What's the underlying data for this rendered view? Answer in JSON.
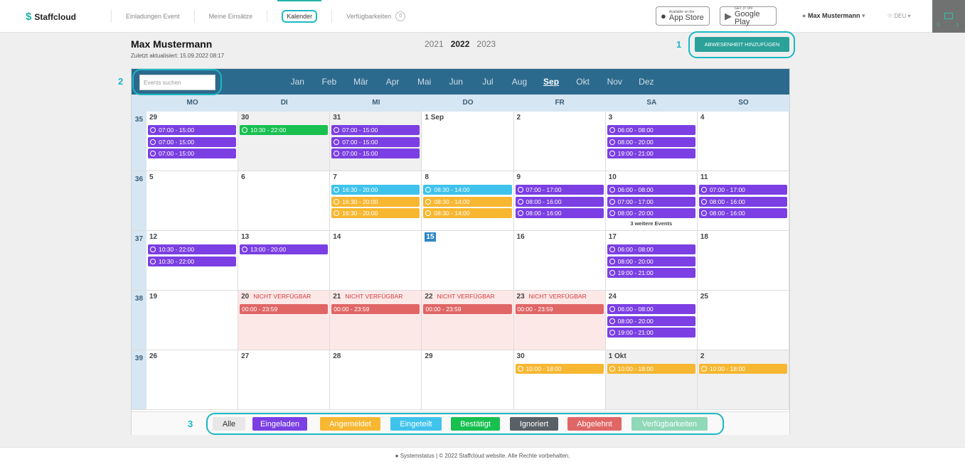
{
  "app": {
    "logo": "Staffcloud"
  },
  "nav": [
    {
      "label": "Einladungen Event",
      "active": false
    },
    {
      "label": "Meine Einsätze",
      "active": false
    },
    {
      "label": "Kalender",
      "active": true
    },
    {
      "label": "Verfügbarkeiten",
      "active": false,
      "badge": "0"
    }
  ],
  "stores": {
    "apple_small": "Available on the",
    "apple_big": "App Store",
    "google_small": "GET IT ON",
    "google_big": "Google Play"
  },
  "header": {
    "user": "Max Mustermann",
    "lang": "DEU",
    "mail_count_a": "0",
    "mail_count_b": "1"
  },
  "page": {
    "title": "Max Mustermann",
    "updated": "Zuletzt aktualisiert: 15.09.2022 08:17",
    "add_button": "ABWESENHEIT HINZUFÜGEN"
  },
  "years": [
    "2021",
    "2022",
    "2023"
  ],
  "current_year": "2022",
  "search": {
    "placeholder": "Events suchen"
  },
  "months": [
    "Jan",
    "Feb",
    "Mär",
    "Apr",
    "Mai",
    "Jun",
    "Jul",
    "Aug",
    "Sep",
    "Okt",
    "Nov",
    "Dez"
  ],
  "selected_month": "Sep",
  "weekdays": [
    "MO",
    "DI",
    "MI",
    "DO",
    "FR",
    "SA",
    "SO"
  ],
  "callouts": [
    "1",
    "2",
    "3"
  ],
  "colors": {
    "purple": "#7b3fe4",
    "green": "#17c04f",
    "blue": "#3fc3ec",
    "orange": "#f7b731",
    "red": "#e06666",
    "teal": "#2aa199",
    "darkgray": "#5a6166",
    "mint": "#8fd8b8"
  },
  "weeks": [
    {
      "num": "35",
      "days": [
        {
          "d": "29",
          "bg": "white",
          "events": [
            {
              "t": "07:00 - 15:00",
              "c": "purple"
            },
            {
              "t": "07:00 - 15:00",
              "c": "purple"
            },
            {
              "t": "07:00 - 15:00",
              "c": "purple"
            }
          ]
        },
        {
          "d": "30",
          "bg": "gray",
          "events": [
            {
              "t": "10:30 - 22:00",
              "c": "green"
            }
          ]
        },
        {
          "d": "31",
          "bg": "gray",
          "events": [
            {
              "t": "07:00 - 15:00",
              "c": "purple"
            },
            {
              "t": "07:00 - 15:00",
              "c": "purple"
            },
            {
              "t": "07:00 - 15:00",
              "c": "purple"
            }
          ]
        },
        {
          "d": "1 Sep",
          "bg": "white",
          "events": []
        },
        {
          "d": "2",
          "bg": "white",
          "events": []
        },
        {
          "d": "3",
          "bg": "white",
          "events": [
            {
              "t": "06:00 - 08:00",
              "c": "purple"
            },
            {
              "t": "08:00 - 20:00",
              "c": "purple"
            },
            {
              "t": "19:00 - 21:00",
              "c": "purple"
            }
          ]
        },
        {
          "d": "4",
          "bg": "white",
          "events": []
        }
      ]
    },
    {
      "num": "36",
      "days": [
        {
          "d": "5",
          "bg": "white",
          "events": []
        },
        {
          "d": "6",
          "bg": "white",
          "events": []
        },
        {
          "d": "7",
          "bg": "white",
          "events": [
            {
              "t": "16:30 - 20:00",
              "c": "blue"
            },
            {
              "t": "16:30 - 20:00",
              "c": "orange"
            },
            {
              "t": "16:30 - 20:00",
              "c": "orange"
            }
          ]
        },
        {
          "d": "8",
          "bg": "white",
          "events": [
            {
              "t": "08:30 - 14:00",
              "c": "blue"
            },
            {
              "t": "08:30 - 14:00",
              "c": "orange"
            },
            {
              "t": "08:30 - 14:00",
              "c": "orange"
            }
          ]
        },
        {
          "d": "9",
          "bg": "white",
          "events": [
            {
              "t": "07:00 - 17:00",
              "c": "purple"
            },
            {
              "t": "08:00 - 16:00",
              "c": "purple"
            },
            {
              "t": "08:00 - 16:00",
              "c": "purple"
            }
          ]
        },
        {
          "d": "10",
          "bg": "white",
          "events": [
            {
              "t": "06:00 - 08:00",
              "c": "purple"
            },
            {
              "t": "07:00 - 17:00",
              "c": "purple"
            },
            {
              "t": "08:00 - 20:00",
              "c": "purple"
            }
          ],
          "more": "3 weitere Events"
        },
        {
          "d": "11",
          "bg": "white",
          "events": [
            {
              "t": "07:00 - 17:00",
              "c": "purple"
            },
            {
              "t": "08:00 - 16:00",
              "c": "purple"
            },
            {
              "t": "08:00 - 16:00",
              "c": "purple"
            }
          ]
        }
      ]
    },
    {
      "num": "37",
      "days": [
        {
          "d": "12",
          "bg": "white",
          "events": [
            {
              "t": "10:30 - 22:00",
              "c": "purple"
            },
            {
              "t": "10:30 - 22:00",
              "c": "purple"
            }
          ]
        },
        {
          "d": "13",
          "bg": "white",
          "events": [
            {
              "t": "13:00 - 20:00",
              "c": "purple"
            }
          ]
        },
        {
          "d": "14",
          "bg": "white",
          "events": []
        },
        {
          "d": "15",
          "bg": "white",
          "today": true,
          "events": []
        },
        {
          "d": "16",
          "bg": "white",
          "events": []
        },
        {
          "d": "17",
          "bg": "white",
          "events": [
            {
              "t": "06:00 - 08:00",
              "c": "purple"
            },
            {
              "t": "08:00 - 20:00",
              "c": "purple"
            },
            {
              "t": "19:00 - 21:00",
              "c": "purple"
            }
          ]
        },
        {
          "d": "18",
          "bg": "white",
          "events": []
        }
      ]
    },
    {
      "num": "38",
      "days": [
        {
          "d": "19",
          "bg": "white",
          "events": []
        },
        {
          "d": "20",
          "bg": "pink",
          "na": "NICHT VERFÜGBAR",
          "events": [
            {
              "t": "00:00 - 23:59",
              "c": "red",
              "cal": true
            }
          ]
        },
        {
          "d": "21",
          "bg": "pink",
          "na": "NICHT VERFÜGBAR",
          "events": [
            {
              "t": "00:00 - 23:59",
              "c": "red",
              "cal": true
            }
          ]
        },
        {
          "d": "22",
          "bg": "pink",
          "na": "NICHT VERFÜGBAR",
          "events": [
            {
              "t": "00:00 - 23:59",
              "c": "red",
              "cal": true
            }
          ]
        },
        {
          "d": "23",
          "bg": "pink",
          "na": "NICHT VERFÜGBAR",
          "events": [
            {
              "t": "00:00 - 23:59",
              "c": "red",
              "cal": true
            }
          ]
        },
        {
          "d": "24",
          "bg": "white",
          "events": [
            {
              "t": "06:00 - 08:00",
              "c": "purple"
            },
            {
              "t": "08:00 - 20:00",
              "c": "purple"
            },
            {
              "t": "19:00 - 21:00",
              "c": "purple"
            }
          ]
        },
        {
          "d": "25",
          "bg": "white",
          "events": []
        }
      ]
    },
    {
      "num": "39",
      "days": [
        {
          "d": "26",
          "bg": "white",
          "events": []
        },
        {
          "d": "27",
          "bg": "white",
          "events": []
        },
        {
          "d": "28",
          "bg": "white",
          "events": []
        },
        {
          "d": "29",
          "bg": "white",
          "events": []
        },
        {
          "d": "30",
          "bg": "white",
          "events": [
            {
              "t": "10:00 - 18:00",
              "c": "orange"
            }
          ]
        },
        {
          "d": "1 Okt",
          "bg": "gray",
          "events": [
            {
              "t": "10:00 - 18:00",
              "c": "orange"
            }
          ]
        },
        {
          "d": "2",
          "bg": "gray",
          "events": [
            {
              "t": "10:00 - 18:00",
              "c": "orange"
            }
          ]
        }
      ]
    }
  ],
  "legend": [
    {
      "label": "Alle",
      "color": "#e8e8e8",
      "text": "#333"
    },
    {
      "label": "Eingeladen",
      "color": "#7b3fe4"
    },
    {
      "label": "Angemeldet",
      "color": "#f7b731"
    },
    {
      "label": "Eingeteilt",
      "color": "#3fc3ec"
    },
    {
      "label": "Bestätigt",
      "color": "#17c04f"
    },
    {
      "label": "Ignoriert",
      "color": "#5a6166"
    },
    {
      "label": "Abgelehnt",
      "color": "#e06666"
    },
    {
      "label": "Verfügbarkeiten",
      "color": "#8fd8b8"
    }
  ],
  "footer": {
    "text": "Systemstatus | © 2022 Staffcloud website. Alle Rechte vorbehalten."
  }
}
